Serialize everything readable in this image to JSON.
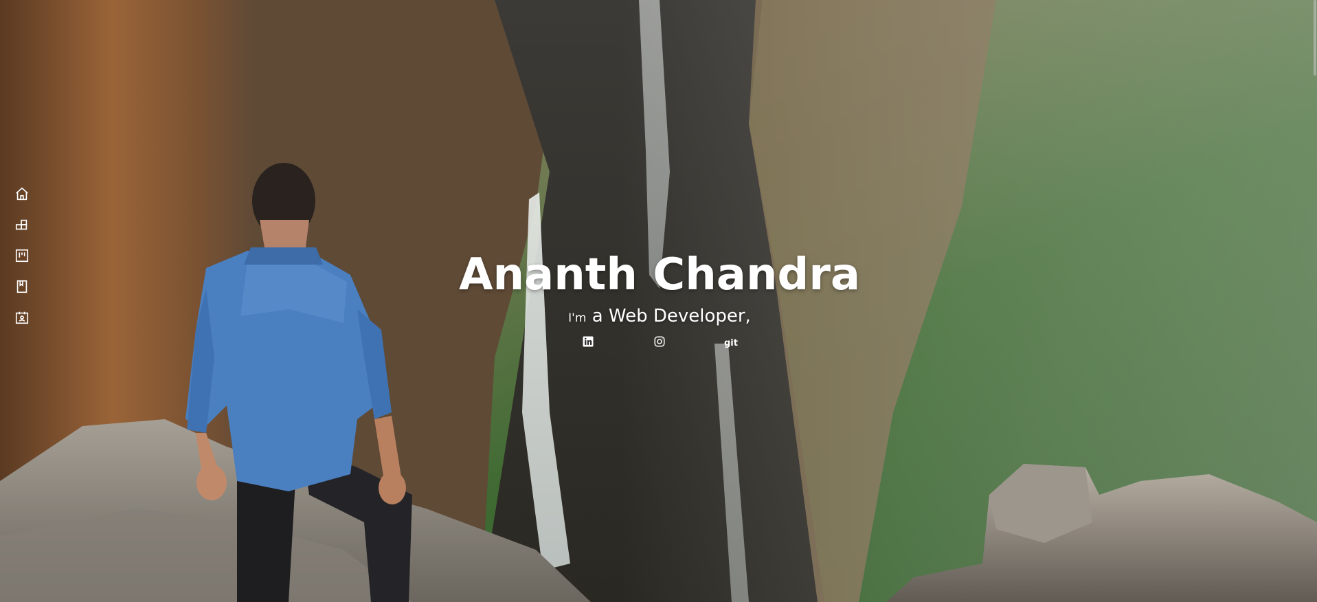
{
  "hero": {
    "name": "Ananth Chandra",
    "tagline_prefix": "I'm",
    "tagline_role": "a Web Developer,"
  },
  "side_nav": {
    "items": [
      {
        "icon": "home-icon"
      },
      {
        "icon": "blocks-icon"
      },
      {
        "icon": "board-icon"
      },
      {
        "icon": "book-icon"
      },
      {
        "icon": "calendar-user-icon"
      }
    ]
  },
  "social": {
    "linkedin_icon": "linkedin-icon",
    "instagram_icon": "instagram-icon",
    "git_label": "git"
  },
  "colors": {
    "text": "#ffffff",
    "denim": "#4a7fc0",
    "cliff": "#8a5a36",
    "forest": "#3f6a32"
  }
}
